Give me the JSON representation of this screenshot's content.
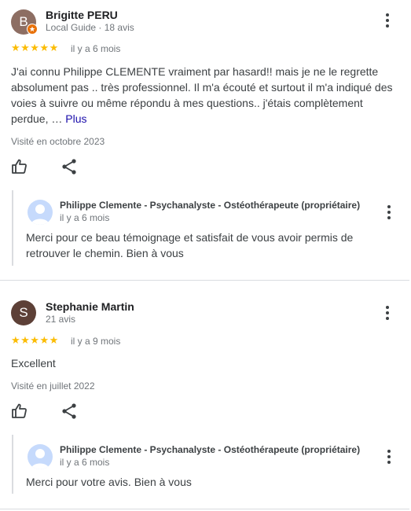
{
  "reviews": [
    {
      "avatar_letter": "B",
      "avatar_color": "#8d6e63",
      "name": "Brigitte PERU",
      "meta": "Local Guide · 18 avis",
      "stars": "★★★★★",
      "date": "il y a 6 mois",
      "text": "J'ai connu Philippe CLEMENTE vraiment par hasard!! mais je ne le regrette absolument pas .. très professionnel. Il m'a écouté et surtout il m'a indiqué des voies à suivre ou même répondu à mes questions.. j'étais complètement perdue, … ",
      "more": "Plus",
      "visited": "Visité en octobre 2023",
      "reply": {
        "name": "Philippe Clemente - Psychanalyste - Ostéothérapeute (propriétaire)",
        "date": "il y a 6 mois",
        "text": "Merci pour ce beau témoignage et satisfait de vous avoir permis de retrouver le chemin. Bien à vous"
      }
    },
    {
      "avatar_letter": "S",
      "avatar_color": "#5d4037",
      "name": "Stephanie Martin",
      "meta": "21 avis",
      "stars": "★★★★★",
      "date": "il y a 9 mois",
      "text": "Excellent",
      "visited": "Visité en juillet 2022",
      "reply": {
        "name": "Philippe Clemente - Psychanalyste - Ostéothérapeute (propriétaire)",
        "date": "il y a 6 mois",
        "text": "Merci pour votre avis. Bien à vous"
      }
    }
  ],
  "colors": {
    "star": "#fbbc04",
    "link": "#1a0dab",
    "badge": "#e8710a"
  },
  "icons": {
    "like": "thumb-up-icon",
    "share": "share-icon",
    "menu": "more-vert-icon",
    "badge": "local-guide-badge-icon"
  }
}
